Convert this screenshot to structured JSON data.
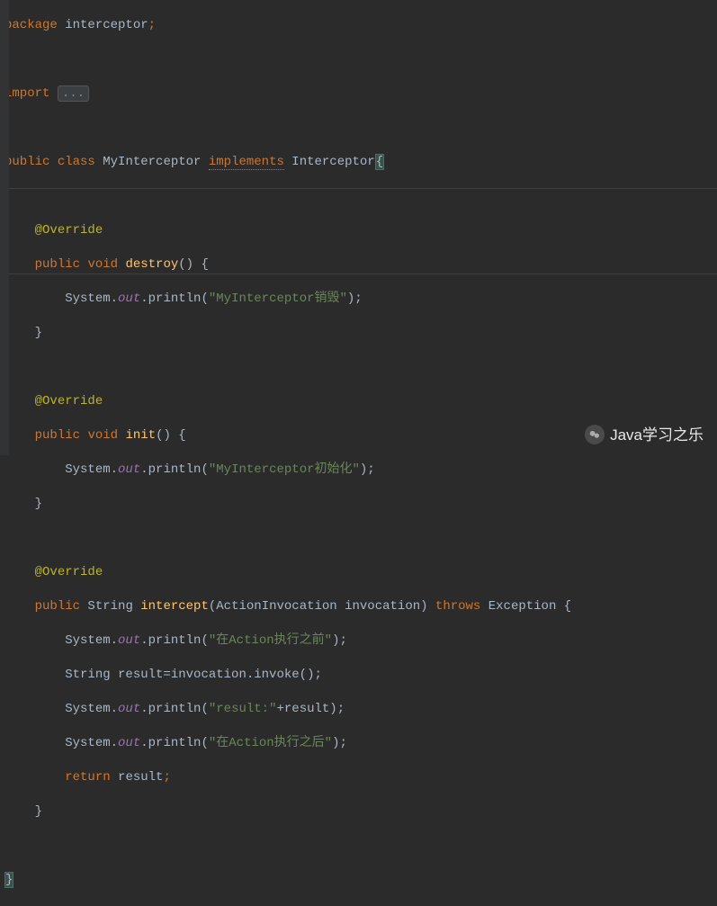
{
  "code": {
    "package_kw": "package",
    "package_name": " interceptor",
    "semicolon": ";",
    "import_kw": "import",
    "import_folded": "...",
    "public_kw": "public",
    "class_kw": "class",
    "class_name": " MyInterceptor ",
    "implements_kw": "implements",
    "interface_name": " Interceptor",
    "open_brace": "{",
    "close_brace": "}",
    "override_annotation": "@Override",
    "void_kw": "void",
    "string_type": " String ",
    "method_destroy": "destroy",
    "method_init": "init",
    "method_intercept": "intercept",
    "parens_empty": "()",
    "parens_open": "(",
    "parens_close": ")",
    "system": "System.",
    "out": "out",
    "println": ".println(",
    "str_destroy": "\"MyInterceptor销毁\"",
    "str_init": "\"MyInterceptor初始化\"",
    "str_before": "\"在Action执行之前\"",
    "str_result": "\"result:\"",
    "str_after": "\"在Action执行之后\"",
    "close_stmt": ");",
    "intercept_params": "ActionInvocation invocation) ",
    "throws_kw": "throws",
    "exception": " Exception {",
    "result_line": "String result=invocation.invoke();",
    "plus_result": "+result);",
    "return_kw": "return",
    "result_var": " result",
    "space_brace": " {",
    "indent1": "    ",
    "indent2": "        "
  },
  "watermark": {
    "text": "Java学习之乐"
  }
}
